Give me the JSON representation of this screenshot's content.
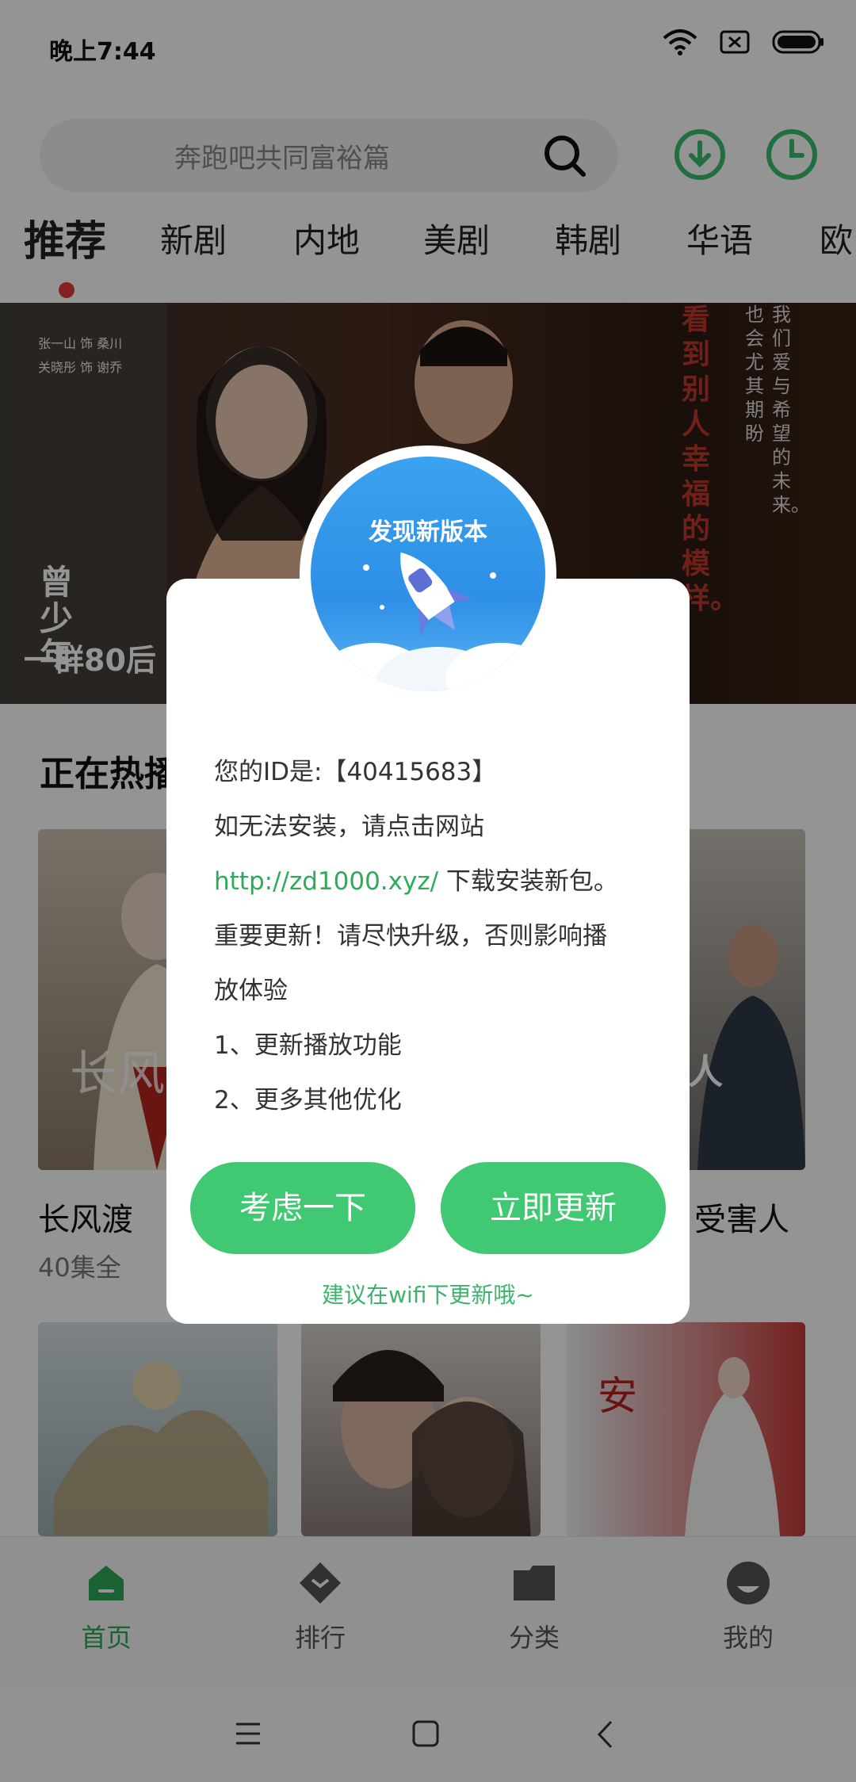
{
  "status_bar": {
    "time": "晚上7:44"
  },
  "search": {
    "placeholder": "奔跑吧共同富裕篇"
  },
  "tabs": [
    "推荐",
    "新剧",
    "内地",
    "美剧",
    "韩剧",
    "华语",
    "欧"
  ],
  "banner": {
    "caption": "一群80后",
    "vertical_text_1": "曾少年",
    "vertical_text_2": "看到别人幸福的模样。",
    "vertical_text_3": "我们爱与希望的未来。",
    "vertical_text_4": "也会尤其期盼",
    "cast_1": "张一山 饰 桑川",
    "cast_2": "关晓彤 饰 谢乔"
  },
  "section": {
    "title": "正在热播"
  },
  "cards": [
    {
      "title": "长风渡",
      "sub": "40集全",
      "poster_text": "长风"
    },
    {
      "title": "受害人",
      "poster_text": "受害人"
    }
  ],
  "bottom_nav": {
    "items": [
      "首页",
      "排行",
      "分类",
      "我的"
    ],
    "active_index": 0
  },
  "dialog": {
    "badge_title": "发现新版本",
    "id_line": "您的ID是:【40415683】",
    "line_install": "如无法安装，请点击网站",
    "link": "http://zd1000.xyz/",
    "link_suffix": " 下载安装新包。",
    "important_1": "重要更新！请尽快升级，否则影响播",
    "important_2": "放体验",
    "item_1": "1、更新播放功能",
    "item_2": "2、更多其他优化",
    "btn_later": "考虑一下",
    "btn_update": "立即更新",
    "hint": "建议在wifi下更新哦~"
  },
  "colors": {
    "accent_green": "#40c872",
    "active_dot": "#e23b3b"
  }
}
